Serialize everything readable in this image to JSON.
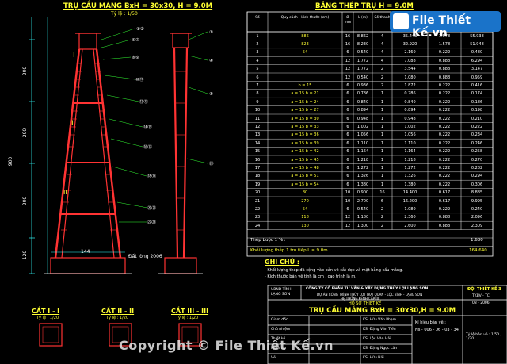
{
  "title_left": "TRỤ CẦU MÁNG BxH = 30x30, H = 9.0M",
  "scale_left": "Tỷ lệ : 1/50",
  "dim_vertical": [
    "200",
    "200",
    "200",
    "900",
    "120"
  ],
  "labels_misc": {
    "dim144": "144",
    "dat_long": "Đất lòng 2006"
  },
  "sections": [
    {
      "title": "CẮT I - I",
      "scale": "Tỷ lệ : 1/20"
    },
    {
      "title": "CẮT II - II",
      "scale": "Tỷ lệ : 1/20"
    },
    {
      "title": "CẮT III - III",
      "scale": "Tỷ lệ : 1/20"
    }
  ],
  "table": {
    "title": "BẢNG THÉP TRỤ H = 9.0M",
    "headers": [
      "Số",
      "Quy cách - kích thước (cm)",
      "Ø mm",
      "L (m)",
      "Số thanh",
      "Tổng chiều dài (m)",
      "Trọng lượng 1m (kg)",
      "Tổng trọng lượng (kg)"
    ],
    "rows": [
      [
        "1",
        "886",
        "16",
        "8.862",
        "4",
        "35.448",
        "1.578",
        "55.938"
      ],
      [
        "2",
        "823",
        "16",
        "8.230",
        "4",
        "32.920",
        "1.578",
        "51.948"
      ],
      [
        "3",
        "54",
        "6",
        "0.540",
        "4",
        "2.160",
        "0.222",
        "0.480"
      ],
      [
        "4",
        "",
        "12",
        "1.772",
        "4",
        "7.088",
        "0.888",
        "6.294"
      ],
      [
        "5",
        "",
        "12",
        "1.772",
        "2",
        "3.544",
        "0.888",
        "3.147"
      ],
      [
        "6",
        "",
        "12",
        "0.540",
        "2",
        "1.080",
        "0.888",
        "0.959"
      ],
      [
        "7",
        "b = 15",
        "6",
        "0.936",
        "2",
        "1.872",
        "0.222",
        "0.416"
      ],
      [
        "8",
        "a = 15   b = 21",
        "6",
        "0.786",
        "1",
        "0.786",
        "0.222",
        "0.174"
      ],
      [
        "9",
        "a = 15   b = 24",
        "6",
        "0.840",
        "1",
        "0.840",
        "0.222",
        "0.186"
      ],
      [
        "10",
        "a = 15   b = 27",
        "6",
        "0.894",
        "1",
        "0.894",
        "0.222",
        "0.198"
      ],
      [
        "11",
        "a = 15   b = 30",
        "6",
        "0.948",
        "1",
        "0.948",
        "0.222",
        "0.210"
      ],
      [
        "12",
        "a = 15   b = 33",
        "6",
        "1.002",
        "1",
        "1.002",
        "0.222",
        "0.222"
      ],
      [
        "13",
        "a = 15   b = 36",
        "6",
        "1.056",
        "1",
        "1.056",
        "0.222",
        "0.234"
      ],
      [
        "14",
        "a = 15   b = 39",
        "6",
        "1.110",
        "1",
        "1.110",
        "0.222",
        "0.246"
      ],
      [
        "15",
        "a = 15   b = 42",
        "6",
        "1.164",
        "1",
        "1.164",
        "0.222",
        "0.258"
      ],
      [
        "16",
        "a = 15   b = 45",
        "6",
        "1.218",
        "1",
        "1.218",
        "0.222",
        "0.270"
      ],
      [
        "17",
        "a = 15   b = 48",
        "6",
        "1.272",
        "1",
        "1.272",
        "0.222",
        "0.282"
      ],
      [
        "18",
        "a = 15   b = 51",
        "6",
        "1.326",
        "1",
        "1.326",
        "0.222",
        "0.294"
      ],
      [
        "19",
        "a = 15   b = 54",
        "6",
        "1.380",
        "1",
        "1.380",
        "0.222",
        "0.306"
      ],
      [
        "20",
        "80",
        "10",
        "0.900",
        "16",
        "14.400",
        "0.617",
        "8.885"
      ],
      [
        "21",
        "270",
        "10",
        "2.700",
        "6",
        "16.200",
        "0.617",
        "9.995"
      ],
      [
        "22",
        "54",
        "6",
        "0.540",
        "2",
        "1.080",
        "0.222",
        "0.240"
      ],
      [
        "23",
        "118",
        "12",
        "1.180",
        "2",
        "2.360",
        "0.888",
        "2.096"
      ],
      [
        "24",
        "130",
        "12",
        "1.300",
        "2",
        "2.600",
        "0.888",
        "2.309"
      ]
    ],
    "extra_row_label": "Thép buộc 1 % :",
    "extra_row_value": "1.630",
    "total_label": "Khối lượng thép 1 trụ tiếp L = 9.0m :",
    "total_value": "164.640"
  },
  "notes": {
    "title": "GHI CHÚ :",
    "lines": [
      "- Khối lượng thép đã cộng vào bản vẽ cắt dọc và mặt bằng cầu máng.",
      "- Kích thước bản vẽ tính là cm , cao trình là m."
    ]
  },
  "title_block": {
    "org_left": "UBND TỈNH LẠNG SƠN",
    "company": "CÔNG TY CỔ PHẦN TƯ VẤN & XÂY DỰNG THỦY LỢI LẠNG SƠN",
    "project": "DỰ ÁN CÔNG TRÌNH THỦY LỢI TRẠI QUAN - LỘC BÌNH - LẠNG SƠN",
    "project2": "HỆ THỐNG KÊNH CẤP III",
    "phase": "HỒ SƠ THIẾT KẾ",
    "drawing_title": "TRỤ CẦU MÁNG BxH = 30x30,H = 9.0M",
    "team": "ĐỘI THIẾT KẾ 3",
    "code1": "TKBV - TC",
    "code2": "08 - 2006",
    "drawing_no_label": "Kí hiệu bản vẽ :",
    "drawing_no": "Ns - 006 - 06 - 03 - 34",
    "scale": "Tỷ lệ bản vẽ : 1/50 ; 1/20",
    "roles": [
      "Giám đốc",
      "Chủ nhiệm",
      "Thiết kế",
      "Kiểm tra",
      "Vẽ"
    ],
    "names": [
      "KS. Hữu Văn Phạm",
      "KS. Đặng Văn Tiến",
      "KS. Lộc Văn Hải",
      "KS. Đặng Ngọc Lân",
      "KS. Hữu Hải"
    ]
  },
  "logo_text": "File Thiết Kế.vn",
  "watermark": "Copyright © File Thiết Kế.vn",
  "colors": {
    "bg": "#000000",
    "red": "#ff3333",
    "cyan": "#33ffff",
    "yellow": "#ffff33",
    "white": "#ffffff",
    "green": "#33ff33"
  }
}
